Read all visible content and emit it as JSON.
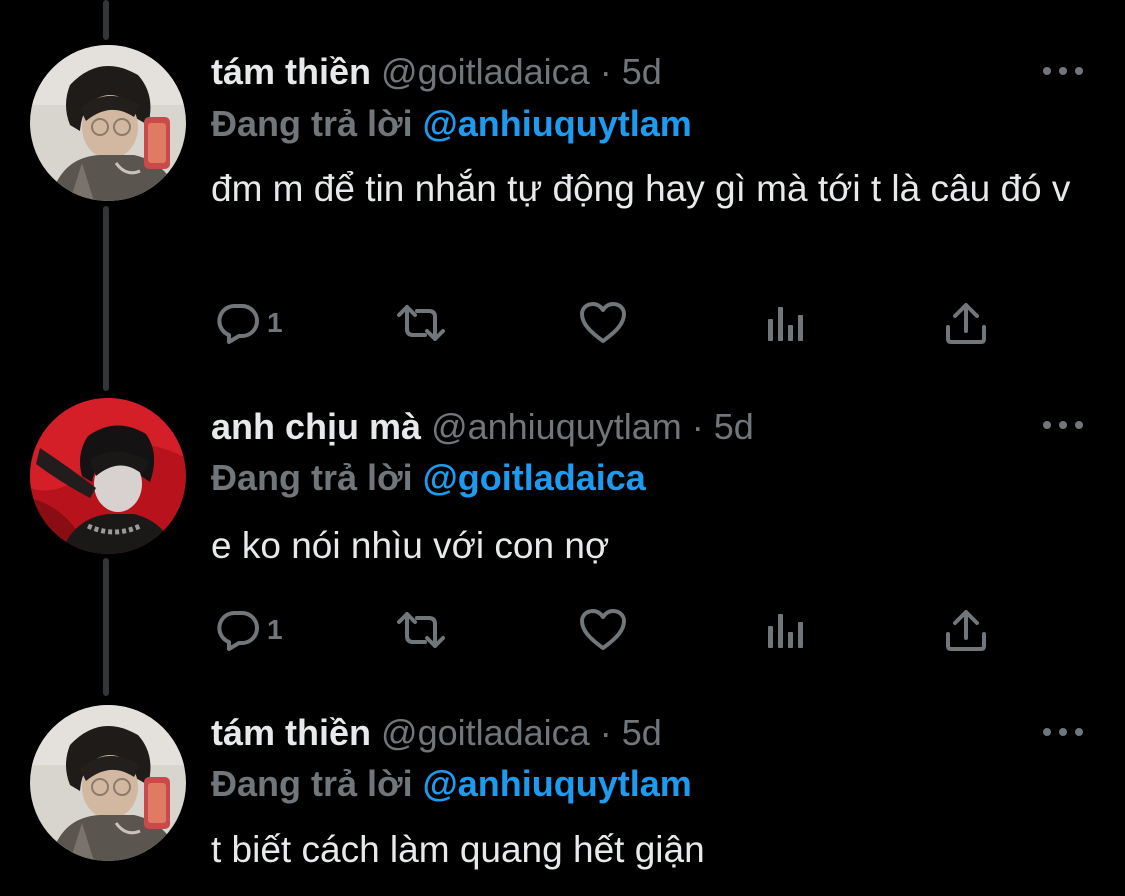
{
  "tweets": [
    {
      "name": "tám thiền",
      "handle": "@goitladaica",
      "separator": "·",
      "time": "5d",
      "reply_prefix": "Đang trả lời",
      "reply_to": "@anhiuquytlam",
      "text": "đm m để tin nhắn tự động hay gì mà tới t là câu đó v",
      "reply_count": "1",
      "avatar_icon": "user-photo-avatar"
    },
    {
      "name": "anh chịu mà",
      "handle": "@anhiuquytlam",
      "separator": "·",
      "time": "5d",
      "reply_prefix": "Đang trả lời",
      "reply_to": "@goitladaica",
      "text": "e ko nói nhìu với con nợ",
      "reply_count": "1",
      "avatar_icon": "user-photo-avatar-red"
    },
    {
      "name": "tám thiền",
      "handle": "@goitladaica",
      "separator": "·",
      "time": "5d",
      "reply_prefix": "Đang trả lời",
      "reply_to": "@anhiuquytlam",
      "text": "t biết cách làm quang hết giận",
      "avatar_icon": "user-photo-avatar"
    }
  ],
  "icons": {
    "reply": "reply-icon",
    "retweet": "retweet-icon",
    "like": "heart-icon",
    "views": "analytics-icon",
    "share": "share-icon",
    "more": "more-icon"
  },
  "colors": {
    "background": "#000000",
    "primary_text": "#e7e9ea",
    "secondary_text": "#71767b",
    "mention": "#1d9bf0",
    "thread_line": "#333639"
  }
}
